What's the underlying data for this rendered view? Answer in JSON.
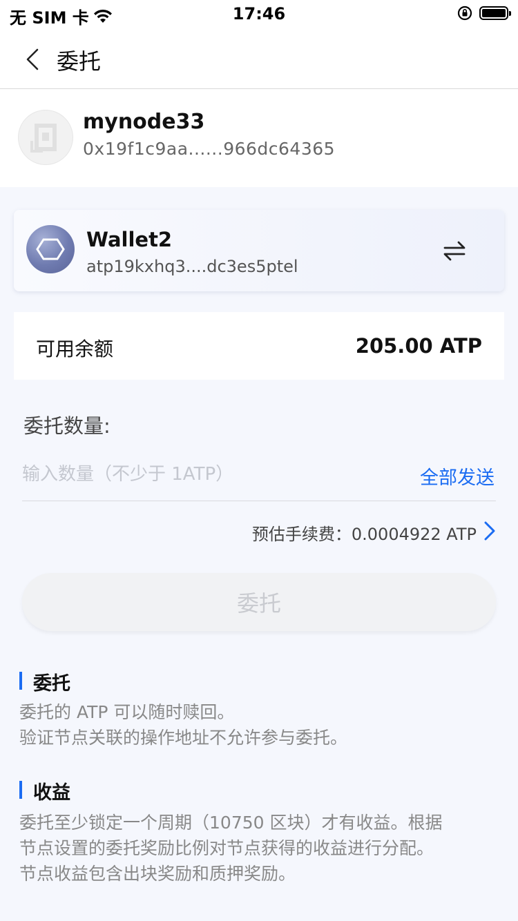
{
  "status_bar": {
    "carrier": "无 SIM 卡",
    "time": "17:46"
  },
  "nav": {
    "title": "委托"
  },
  "node": {
    "name": "mynode33",
    "address": "0x19f1c9aa......966dc64365"
  },
  "wallet": {
    "name": "Wallet2",
    "address": "atp19kxhq3....dc3es5ptel"
  },
  "balance": {
    "label": "可用余额",
    "value": "205.00 ATP"
  },
  "amount": {
    "label": "委托数量:",
    "placeholder": "输入数量（不少于 1ATP）",
    "send_all": "全部发送"
  },
  "fee": {
    "text": "预估手续费：0.0004922 ATP"
  },
  "submit": {
    "label": "委托"
  },
  "sections": [
    {
      "title": "委托",
      "lines": [
        "委托的 ATP 可以随时赎回。",
        "验证节点关联的操作地址不允许参与委托。"
      ]
    },
    {
      "title": "收益",
      "lines": [
        "委托至少锁定一个周期（10750 区块）才有收益。根据",
        "节点设置的委托奖励比例对节点获得的收益进行分配。",
        "节点收益包含出块奖励和质押奖励。"
      ]
    }
  ],
  "colors": {
    "accent": "#1b6cf2"
  }
}
